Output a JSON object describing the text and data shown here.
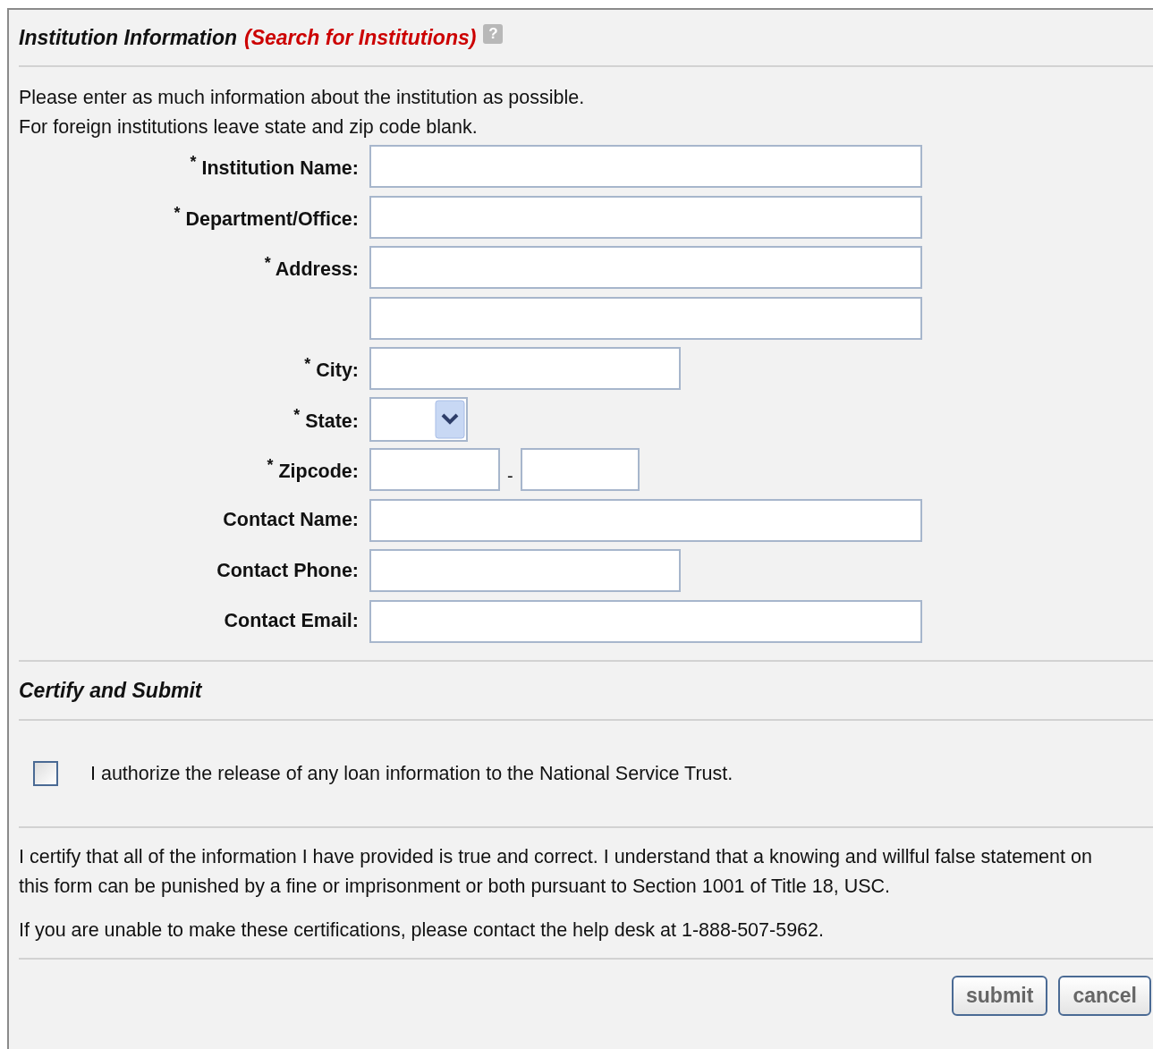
{
  "section": {
    "title": "Institution Information",
    "link": "(Search for Institutions)",
    "help": "?"
  },
  "intro": [
    "Please enter as much information about the institution as possible.",
    "For foreign institutions leave state and zip code blank."
  ],
  "fields": [
    {
      "label": "$^{*}$ Institution Name:",
      "kind": "wide"
    },
    {
      "label": "$^{*}$ Department/Office:",
      "kind": "wide"
    },
    {
      "label": "$^{*}$ Address:",
      "kind": "wide"
    },
    {
      "kind": "wide"
    },
    {
      "label": "$^{*}$ City:",
      "kind": "medium"
    },
    {
      "label": "$^{*}$ State:",
      "kind": "select"
    },
    {
      "label": "$^{*}$ Zipcode:",
      "kind": "zip",
      "separator": "-"
    },
    {
      "label": "Contact Name:",
      "kind": "wide"
    },
    {
      "label": "Contact Phone:",
      "kind": "medium"
    },
    {
      "label": "Contact Email:",
      "kind": "wide"
    }
  ],
  "certify": {
    "title": "Certify and Submit",
    "authorize": {
      "label": "I authorize the release of any loan information to the National Service Trust.",
      "checked": false
    },
    "statement": "I certify that all of the information I have provided is true and correct. I understand that a knowing and willful false statement on this form can be punished by a fine or imprisonment or both pursuant to Section 1001 of Title 18, USC.",
    "help": "If you are unable to make these certifications, please contact the help desk at 1-888-507-5962."
  },
  "buttons": [
    "submit",
    "cancel"
  ]
}
